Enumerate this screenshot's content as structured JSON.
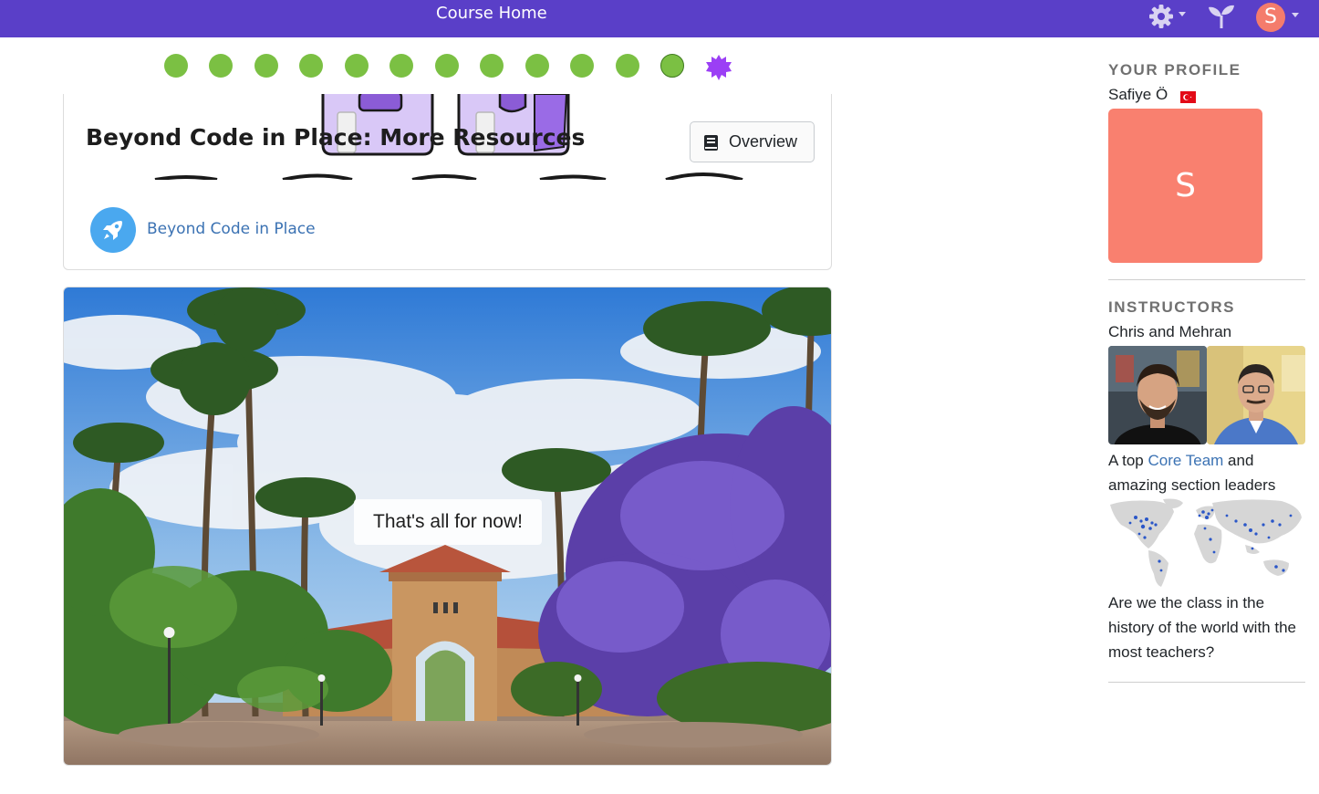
{
  "nav": {
    "title": "Course Home",
    "avatar_initial": "S",
    "brand_color": "#5a3fc8"
  },
  "progress": {
    "completed_count": 11,
    "current_index": 12,
    "dot_color": "#7bc043",
    "badge_color": "#9b3ff5"
  },
  "card1": {
    "title": "Beyond Code in Place: More Resources",
    "overview_label": "Overview",
    "link_label": "Beyond Code in Place"
  },
  "card2": {
    "caption": "That's all for now!"
  },
  "sidebar": {
    "profile_heading": "YOUR PROFILE",
    "profile_name": "Safiye Ö",
    "profile_initial": "S",
    "flag": "turkey-flag",
    "instructors_heading": "INSTRUCTORS",
    "instructors_names": "Chris and Mehran",
    "team_prefix": "A top ",
    "team_link": "Core Team",
    "team_suffix": " and amazing section leaders",
    "teachers_text": "Are we the class in the history of the world with the most teachers?"
  }
}
